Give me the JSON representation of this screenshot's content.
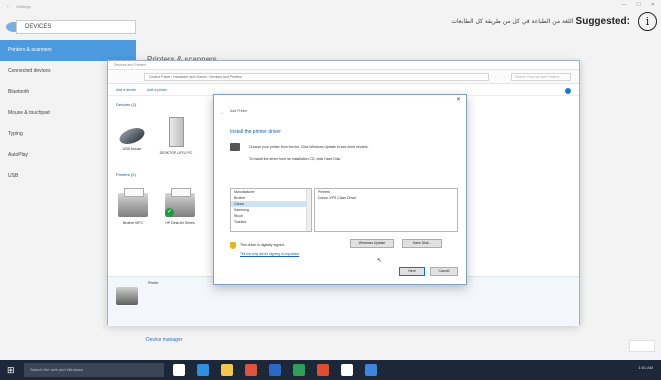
{
  "settings": {
    "window_title": "Settings",
    "search_value": "DEVICES",
    "window_controls": [
      "—",
      "☐",
      "✕"
    ],
    "nav": [
      {
        "label": "Printers & scanners",
        "active": true
      },
      {
        "label": "Connected devices",
        "active": false
      },
      {
        "label": "Bluetooth",
        "active": false
      },
      {
        "label": "Mouse & touchpad",
        "active": false
      },
      {
        "label": "Typing",
        "active": false
      },
      {
        "label": "AutoPlay",
        "active": false
      },
      {
        "label": "USB",
        "active": false
      }
    ],
    "content_title": "Printers & scanners",
    "related": [
      "Devices and printers",
      "Device manager"
    ]
  },
  "banner": {
    "label": "Suggested:",
    "arabic_text": "اللغة من الطباعة في كل من طريقة كل الطابعات",
    "icon": "info-circle-icon"
  },
  "devices_window": {
    "title": "Devices and Printers",
    "breadcrumb": "Control Panel › Hardware and Sound › Devices and Printers",
    "search_placeholder": "Search Devices and Printers",
    "commands": [
      "Add a device",
      "Add a printer"
    ],
    "group_devices": "Devices (2)",
    "group_printers": "Printers (2)",
    "devices": [
      {
        "label": "USB Mouse",
        "icon": "mouse-icon"
      },
      {
        "label": "DESKTOP-UFGJ PC",
        "icon": "computer-tower-icon"
      }
    ],
    "printers": [
      {
        "label": "Brother MFC",
        "icon": "printer-icon"
      },
      {
        "label": "HP DeskJet Series",
        "icon": "printer-icon"
      }
    ],
    "bottom_label": "Printer"
  },
  "add_printer": {
    "window_title": "Add Printer",
    "heading": "Install the printer driver",
    "description_1": "Choose your printer from the list. Click Windows Update to see more models.",
    "description_2": "To install the driver from an installation CD, click Have Disk.",
    "manufacturer_header": "Manufacturer",
    "manufacturers": [
      {
        "label": "Brother",
        "selected": false
      },
      {
        "label": "Canon",
        "selected": true
      },
      {
        "label": "Samsung",
        "selected": false
      },
      {
        "label": "Ricoh",
        "selected": false
      },
      {
        "label": "Toshiba",
        "selected": false
      }
    ],
    "printers_header": "Printers",
    "printers": [
      "Canon XPS Class Driver"
    ],
    "signed_text": "This driver is digitally signed.",
    "signing_link": "Tell me why driver signing is important",
    "windows_update_button": "Windows Update",
    "have_disk_button": "Have Disk...",
    "next_button": "Next",
    "cancel_button": "Cancel"
  },
  "taskbar": {
    "search_placeholder": "Search the web and Windows",
    "apps": [
      {
        "name": "task-view-icon",
        "color": "#ffffff"
      },
      {
        "name": "edge-icon",
        "color": "#2f8fe0"
      },
      {
        "name": "file-explorer-icon",
        "color": "#f2c94c"
      },
      {
        "name": "chrome-icon",
        "color": "#e0533d"
      },
      {
        "name": "photoshop-icon",
        "color": "#2b68c8"
      },
      {
        "name": "store-icon",
        "color": "#2f9e57"
      },
      {
        "name": "office-icon",
        "color": "#e14e2f"
      },
      {
        "name": "media-icon",
        "color": "#ffffff"
      },
      {
        "name": "settings-app-icon",
        "color": "#3c86e0"
      }
    ],
    "tray_time": "1:51 AM"
  }
}
